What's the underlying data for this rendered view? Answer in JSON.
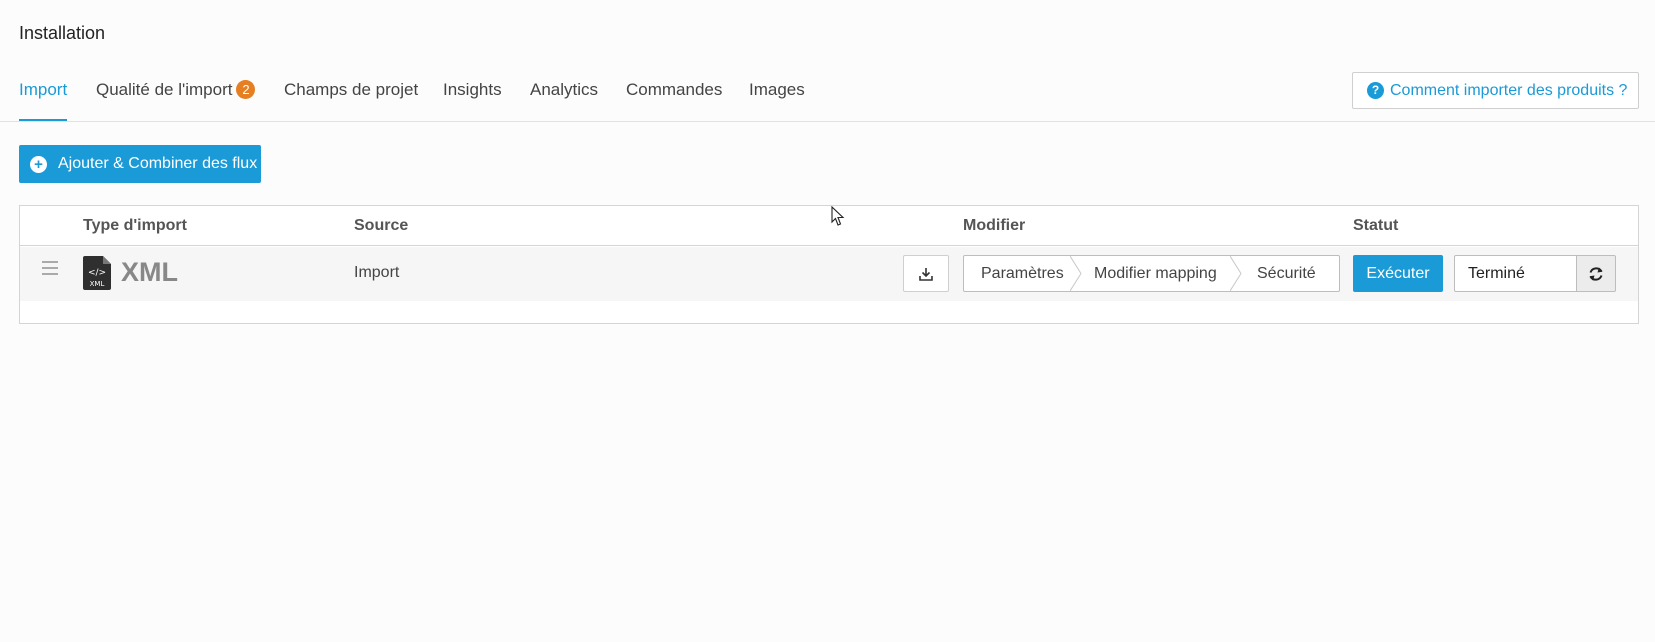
{
  "page_title": "Installation",
  "tabs": [
    {
      "label": "Import",
      "active": true
    },
    {
      "label": "Qualité de l'import",
      "badge": "2"
    },
    {
      "label": "Champs de projet"
    },
    {
      "label": "Insights"
    },
    {
      "label": "Analytics"
    },
    {
      "label": "Commandes"
    },
    {
      "label": "Images"
    }
  ],
  "help_button": {
    "label": "Comment importer des produits ?",
    "icon": "question-circle-icon"
  },
  "add_button": {
    "label": "Ajouter & Combiner des flux",
    "icon": "plus-circle-icon"
  },
  "table": {
    "columns": [
      "Type d'import",
      "Source",
      "Modifier",
      "Statut"
    ],
    "rows": [
      {
        "type_label": "XML",
        "type_icon": "xml-file-icon",
        "type_icon_text": "XML",
        "source": "Import",
        "modifier_steps": [
          "Paramètres",
          "Modifier mapping",
          "Sécurité"
        ],
        "run_label": "Exécuter",
        "status": "Terminé"
      }
    ]
  },
  "colors": {
    "accent": "#1a9ad6",
    "badge": "#e67e22",
    "text": "#444444"
  }
}
